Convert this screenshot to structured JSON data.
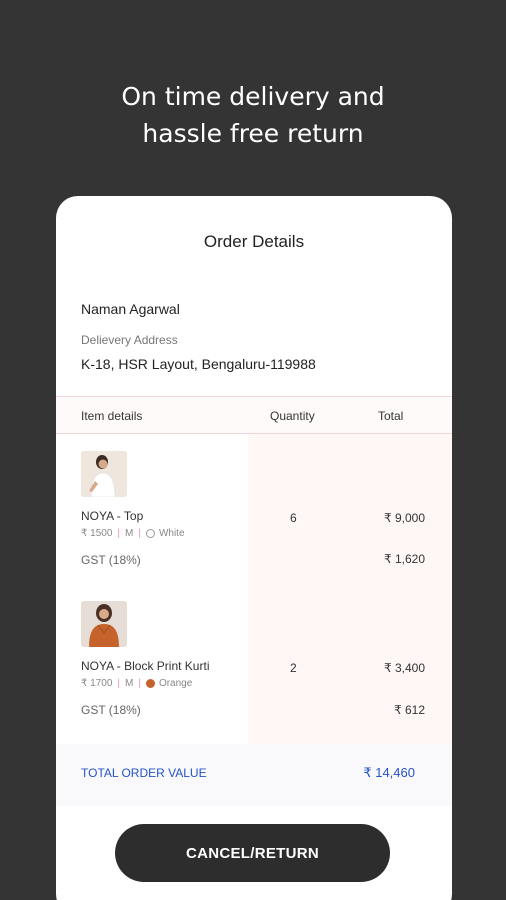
{
  "headline": {
    "line1": "On time delivery and",
    "line2": "hassle free return"
  },
  "card": {
    "title": "Order Details",
    "customer_name": "Naman Agarwal",
    "address_label": "Delievery Address",
    "address_value": "K-18, HSR Layout, Bengaluru-119988"
  },
  "table": {
    "headers": {
      "item": "Item details",
      "quantity": "Quantity",
      "total": "Total"
    },
    "items": [
      {
        "name": "NOYA - Top",
        "price": "₹ 1500",
        "size": "M",
        "color_name": "White",
        "color": "#ffffff",
        "quantity": "6",
        "total": "₹ 9,000",
        "gst_label": "GST (18%)",
        "gst_value": "₹ 1,620"
      },
      {
        "name": "NOYA - Block Print Kurti",
        "price": "₹ 1700",
        "size": "M",
        "color_name": "Orange",
        "color": "#c6632c",
        "quantity": "2",
        "total": "₹ 3,400",
        "gst_label": "GST (18%)",
        "gst_value": "₹ 612"
      }
    ]
  },
  "summary": {
    "label": "TOTAL ORDER VALUE",
    "value": "₹ 14,460"
  },
  "action": {
    "label": "CANCEL/RETURN"
  },
  "colors": {
    "background": "#343434",
    "accent_blue": "#2452c7",
    "button": "#2d2d2d"
  }
}
